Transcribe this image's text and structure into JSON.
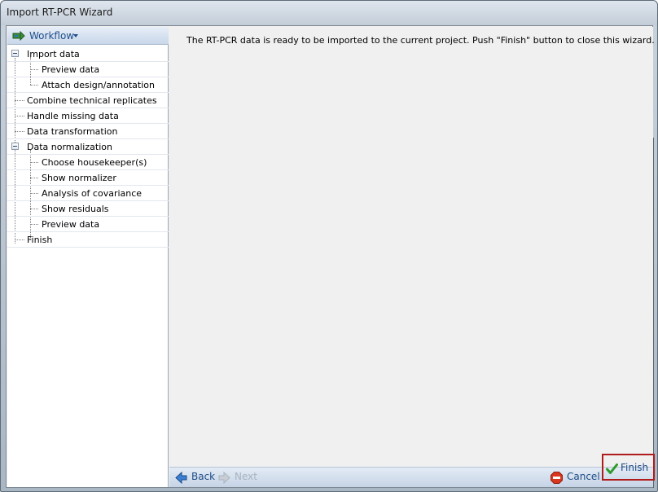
{
  "window": {
    "title": "Import RT-PCR Wizard"
  },
  "workflow": {
    "label": "Workflow",
    "items": [
      {
        "label": "Import data",
        "level": 1,
        "expandable": true
      },
      {
        "label": "Preview data",
        "level": 2
      },
      {
        "label": "Attach design/annotation",
        "level": 2
      },
      {
        "label": "Combine technical replicates",
        "level": 1
      },
      {
        "label": "Handle missing data",
        "level": 1
      },
      {
        "label": "Data transformation",
        "level": 1
      },
      {
        "label": "Data normalization",
        "level": 1,
        "expandable": true
      },
      {
        "label": "Choose housekeeper(s)",
        "level": 2
      },
      {
        "label": "Show normalizer",
        "level": 2
      },
      {
        "label": "Analysis of covariance",
        "level": 2
      },
      {
        "label": "Show residuals",
        "level": 2
      },
      {
        "label": "Preview data",
        "level": 2
      },
      {
        "label": "Finish",
        "level": 1
      }
    ]
  },
  "content": {
    "message": "The RT-PCR data is ready to be imported to the current project. Push \"Finish\" button to close this wizard."
  },
  "buttons": {
    "back": "Back",
    "next": "Next",
    "cancel": "Cancel",
    "finish": "Finish"
  },
  "icons": {
    "workflow": "workflow-arrow-icon",
    "back": "arrow-left-icon",
    "next": "arrow-right-icon",
    "cancel": "stop-icon",
    "finish": "checkmark-icon"
  },
  "colors": {
    "accent": "#1d4b86",
    "finish_highlight": "#b01b1b",
    "disabled": "#a8b3bf"
  }
}
